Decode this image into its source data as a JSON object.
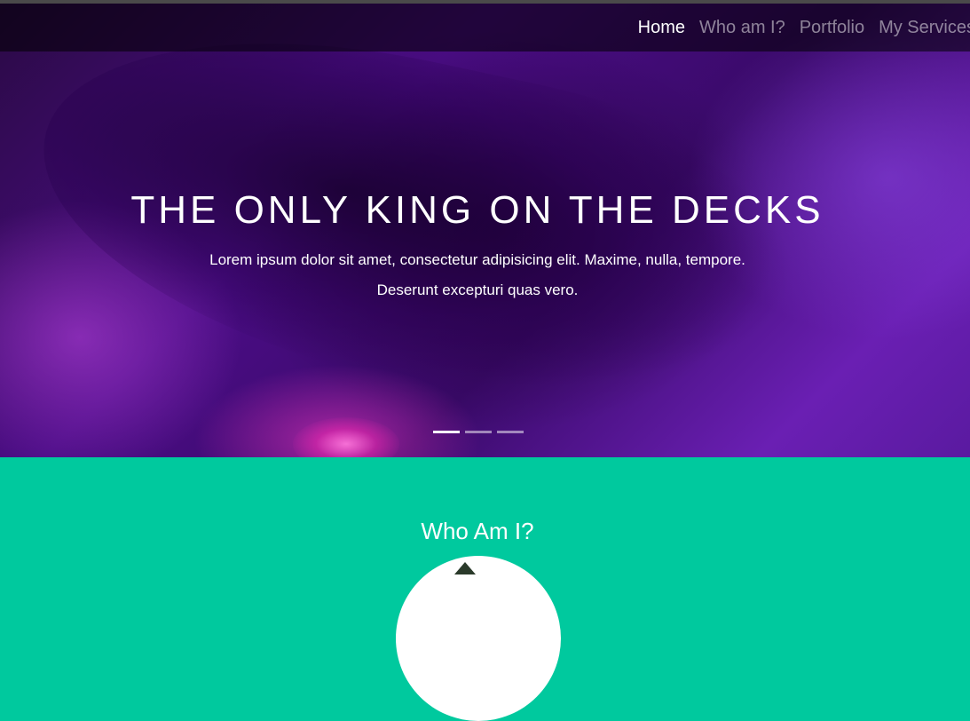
{
  "nav": {
    "items": [
      {
        "label": "Home"
      },
      {
        "label": "Who am I?"
      },
      {
        "label": "Portfolio"
      },
      {
        "label": "My Services"
      }
    ]
  },
  "hero": {
    "title": "THE ONLY KING ON THE DECKS",
    "text": "Lorem ipsum dolor sit amet, consectetur adipisicing elit. Maxime, nulla, tempore. Deserunt excepturi quas vero.",
    "slide_count": 3,
    "active_slide": 1
  },
  "about": {
    "title": "Who Am I?"
  },
  "colors": {
    "accent": "#00c99e",
    "hero_purple": "#4b0d86"
  }
}
